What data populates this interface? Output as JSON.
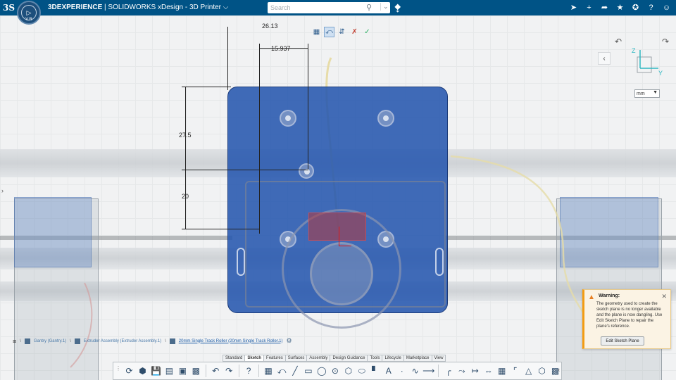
{
  "header": {
    "brand_bold": "3DEXPERIENCE",
    "brand_rest": "| SOLIDWORKS xDesign - 3D Printer",
    "caret": "⌵",
    "compass_version": "V.R",
    "search_placeholder": "Search"
  },
  "top_icons": [
    "share-icon",
    "add-icon",
    "forward-icon",
    "network-icon",
    "tools-icon",
    "help-icon",
    "user-icon"
  ],
  "dimensions": {
    "top_partial": "26.13",
    "horizontal": "15.937",
    "vertical_upper": "27.5",
    "vertical_lower": "20"
  },
  "units": {
    "selected": "mm",
    "options": [
      "mm"
    ]
  },
  "view_cube": {
    "z": "Z",
    "y": "Y"
  },
  "warning": {
    "title": "Warning:",
    "body": "The geometry used to create the sketch plane is no longer available and the plane is now dangling. Use Edit Sketch Plane to repair the plane's reference.",
    "button": "Edit Sketch Plane"
  },
  "breadcrumb": {
    "items": [
      "Gantry (Gantry.1)",
      "Extruder Assembly (Extruder Assembly.1)",
      "20mm Single Track Roller (20mm Single Track Roller.1)"
    ]
  },
  "action_tabs": [
    "Standard",
    "Sketch",
    "Features",
    "Surfaces",
    "Assembly",
    "Design Guidance",
    "Tools",
    "Lifecycle",
    "Marketplace",
    "View"
  ],
  "active_tab": "Sketch",
  "colors": {
    "topbar": "#005386",
    "part": "#2656ae",
    "warning_accent": "#f39c12",
    "sketch_red": "#e01818"
  }
}
